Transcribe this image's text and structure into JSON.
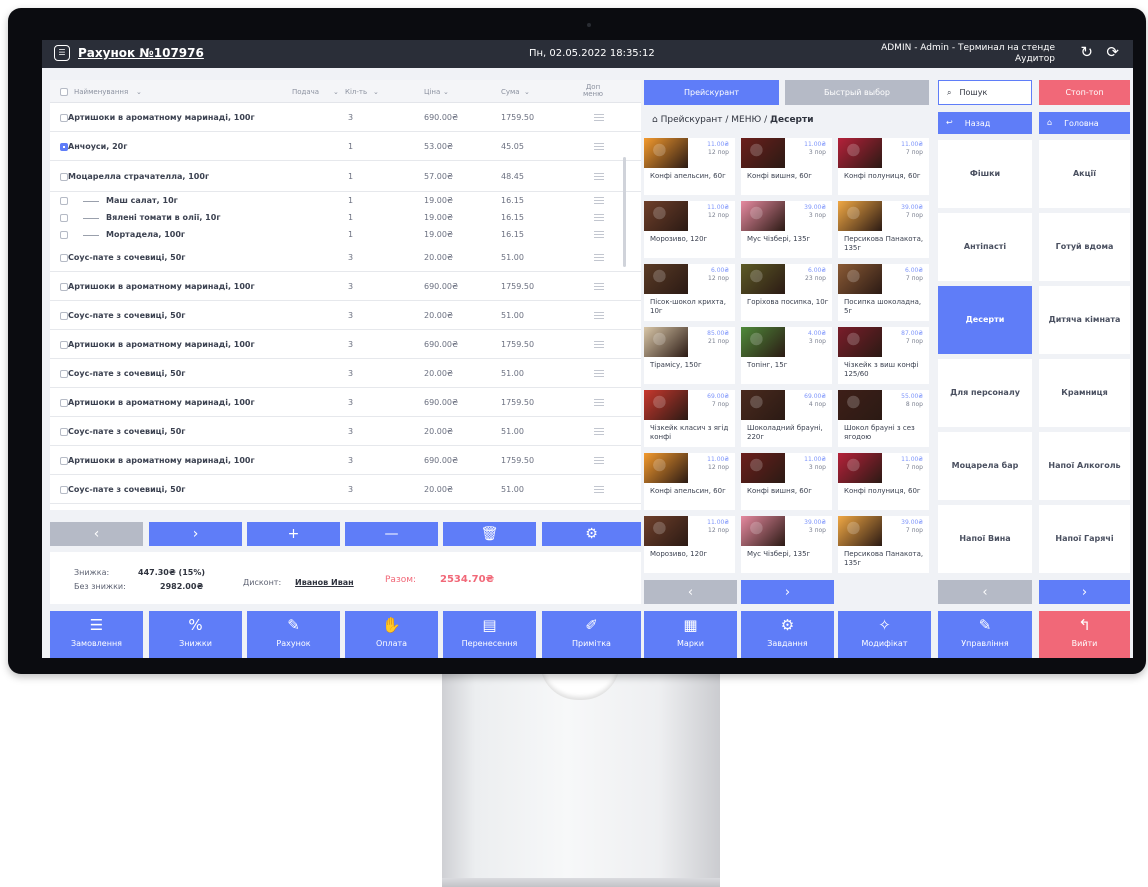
{
  "header": {
    "title": "Рахунок №107976",
    "datetime": "Пн, 02.05.2022  18:35:12",
    "user_line1": "ADMIN - Admin - Терминал на стенде",
    "user_line2": "Аудитор",
    "icon_sync": "sync-icon",
    "icon_refresh": "refresh-icon"
  },
  "table": {
    "columns": {
      "name": "Найменування",
      "serve": "Подача",
      "qty": "Кіл-ть",
      "price": "Ціна",
      "sum": "Сума",
      "menu": "Доп меню"
    },
    "rows": [
      {
        "name": "Артишоки в ароматному маринаді, 100г",
        "qty": "3",
        "price": "690.00₴",
        "sum": "1759.50",
        "checked": false
      },
      {
        "name": "Анчоуси, 20г",
        "qty": "1",
        "price": "53.00₴",
        "sum": "45.05",
        "checked": true
      },
      {
        "name": "Моцарелла страчателла, 100г",
        "qty": "1",
        "price": "57.00₴",
        "sum": "48.45",
        "checked": false
      },
      {
        "name": "Маш салат, 10г",
        "qty": "1",
        "price": "19.00₴",
        "sum": "16.15",
        "sub": true
      },
      {
        "name": "Вялені томати в олії, 10г",
        "qty": "1",
        "price": "19.00₴",
        "sum": "16.15",
        "sub": true
      },
      {
        "name": "Мортадела, 100г",
        "qty": "1",
        "price": "19.00₴",
        "sum": "16.15",
        "sub": true
      },
      {
        "name": "Соус-пате з сочевиці, 50г",
        "qty": "3",
        "price": "20.00₴",
        "sum": "51.00"
      },
      {
        "name": "Артишоки в ароматному маринаді, 100г",
        "qty": "3",
        "price": "690.00₴",
        "sum": "1759.50"
      },
      {
        "name": "Соус-пате з сочевиці, 50г",
        "qty": "3",
        "price": "20.00₴",
        "sum": "51.00"
      },
      {
        "name": "Артишоки в ароматному маринаді, 100г",
        "qty": "3",
        "price": "690.00₴",
        "sum": "1759.50"
      },
      {
        "name": "Соус-пате з сочевиці, 50г",
        "qty": "3",
        "price": "20.00₴",
        "sum": "51.00"
      },
      {
        "name": "Артишоки в ароматному маринаді, 100г",
        "qty": "3",
        "price": "690.00₴",
        "sum": "1759.50"
      },
      {
        "name": "Соус-пате з сочевиці, 50г",
        "qty": "3",
        "price": "20.00₴",
        "sum": "51.00"
      },
      {
        "name": "Артишоки в ароматному маринаді, 100г",
        "qty": "3",
        "price": "690.00₴",
        "sum": "1759.50"
      },
      {
        "name": "Соус-пате з сочевиці, 50г",
        "qty": "3",
        "price": "20.00₴",
        "sum": "51.00"
      }
    ]
  },
  "toolbar": {
    "prev": "‹",
    "next": "›",
    "add": "+",
    "remove": "—",
    "delete_icon": "trash-icon",
    "settings_icon": "gear-icon"
  },
  "summary": {
    "discount_label": "Знижка:",
    "discount_value": "447.30₴ (15%)",
    "nodiscount_label": "Без знижки:",
    "nodiscount_value": "2982.00₴",
    "card_label": "Дисконт:",
    "card_value": "Иванов Иван",
    "total_label": "Разом:",
    "total_value": "2534.70₴"
  },
  "bottom_bar": [
    {
      "label": "Замовлення",
      "icon": "order-icon",
      "glyph": "☰"
    },
    {
      "label": "Знижки",
      "icon": "discount-icon",
      "glyph": "%"
    },
    {
      "label": "Рахунок",
      "icon": "invoice-icon",
      "glyph": "✎"
    },
    {
      "label": "Оплата",
      "icon": "payment-icon",
      "glyph": "✋"
    },
    {
      "label": "Перенесення",
      "icon": "transfer-icon",
      "glyph": "▤"
    },
    {
      "label": "Примітка",
      "icon": "note-icon",
      "glyph": "✐"
    },
    {
      "label": "Марки",
      "icon": "marks-icon",
      "glyph": "▦"
    },
    {
      "label": "Завдання",
      "icon": "task-icon",
      "glyph": "⚙"
    },
    {
      "label": "Модифікат",
      "icon": "modifier-icon",
      "glyph": "✧"
    },
    {
      "label": "Управління",
      "icon": "wrench-icon",
      "glyph": "✎"
    },
    {
      "label": "Вийти",
      "icon": "exit-icon",
      "glyph": "↰"
    }
  ],
  "menu": {
    "tab_price": "Прейскурант",
    "tab_quick": "Быстрый выбор",
    "crumb_root": "Прейскурант",
    "crumb_mid": "МЕНЮ",
    "crumb_cur": "Десерти",
    "home_icon": "home-icon",
    "items": [
      {
        "name": "Конфі апельсин, 60г",
        "price": "11.00₴",
        "portions": "12 пор",
        "color": "#f39a2e"
      },
      {
        "name": "Конфі вишня, 60г",
        "price": "11.00₴",
        "portions": "3 пор",
        "color": "#6b1f1c"
      },
      {
        "name": "Конфі полуниця, 60г",
        "price": "11.00₴",
        "portions": "7 пор",
        "color": "#b5213a"
      },
      {
        "name": "Морозиво, 120г",
        "price": "11.00₴",
        "portions": "12 пор",
        "color": "#6e3f2a"
      },
      {
        "name": "Мус Чізбері, 135г",
        "price": "39.00₴",
        "portions": "3 пор",
        "color": "#e68aa0"
      },
      {
        "name": "Персикова Панакота, 135г",
        "price": "39.00₴",
        "portions": "7 пор",
        "color": "#f0a844"
      },
      {
        "name": "Пісок-шокол крихта, 10г",
        "price": "6.00₴",
        "portions": "12 пор",
        "color": "#5a3b26"
      },
      {
        "name": "Горіхова посипка, 10г",
        "price": "6.00₴",
        "portions": "23 пор",
        "color": "#5c5a26"
      },
      {
        "name": "Посипка шоколадна, 5г",
        "price": "6.00₴",
        "portions": "7 пор",
        "color": "#8a5a35"
      },
      {
        "name": "Тірамісу, 150г",
        "price": "85.00₴",
        "portions": "21 пор",
        "color": "#d9c7a8"
      },
      {
        "name": "Топінг, 15г",
        "price": "4.00₴",
        "portions": "3 пор",
        "color": "#4f8a3a"
      },
      {
        "name": "Чізкейк з виш конфі 125/60",
        "price": "87.00₴",
        "portions": "7 пор",
        "color": "#7a1d2a"
      },
      {
        "name": "Чізкейк класич з ягід конфі",
        "price": "69.00₴",
        "portions": "7 пор",
        "color": "#c8382e"
      },
      {
        "name": "Шоколадний брауні, 220г",
        "price": "69.00₴",
        "portions": "4 пор",
        "color": "#4a2a1e"
      },
      {
        "name": "Шокол брауні з сез ягодою",
        "price": "55.00₴",
        "portions": "8 пор",
        "color": "#3e1f18"
      },
      {
        "name": "Конфі апельсин, 60г",
        "price": "11.00₴",
        "portions": "12 пор",
        "color": "#f39a2e"
      },
      {
        "name": "Конфі вишня, 60г",
        "price": "11.00₴",
        "portions": "3 пор",
        "color": "#6b1f1c"
      },
      {
        "name": "Конфі полуниця, 60г",
        "price": "11.00₴",
        "portions": "7 пор",
        "color": "#b5213a"
      },
      {
        "name": "Морозиво, 120г",
        "price": "11.00₴",
        "portions": "12 пор",
        "color": "#6e3f2a"
      },
      {
        "name": "Мус Чізбері, 135г",
        "price": "39.00₴",
        "portions": "3 пор",
        "color": "#e68aa0"
      },
      {
        "name": "Персикова Панакота, 135г",
        "price": "39.00₴",
        "portions": "7 пор",
        "color": "#f0a844"
      }
    ],
    "prev": "‹",
    "next": "›"
  },
  "right": {
    "search_label": "Пошук",
    "search_icon": "search-icon",
    "stop_label": "Стоп-топ",
    "back_label": "Назад",
    "back_icon": "back-arrow-icon",
    "home_label": "Головна",
    "home_icon": "home-icon",
    "categories": [
      {
        "label": "Фішки",
        "active": false
      },
      {
        "label": "Акції",
        "active": false
      },
      {
        "label": "Антіпасті",
        "active": false
      },
      {
        "label": "Готуй вдома",
        "active": false
      },
      {
        "label": "Десерти",
        "active": true
      },
      {
        "label": "Дитяча кімната",
        "active": false
      },
      {
        "label": "Для персоналу",
        "active": false
      },
      {
        "label": "Крамниця",
        "active": false
      },
      {
        "label": "Моцарела бар",
        "active": false
      },
      {
        "label": "Напої Алкоголь",
        "active": false
      },
      {
        "label": "Напої Вина",
        "active": false
      },
      {
        "label": "Напої Гарячі",
        "active": false
      }
    ],
    "prev": "‹",
    "next": "›"
  },
  "colors": {
    "accent": "#5f7df8",
    "danger": "#f16878",
    "disabled": "#b5bac6",
    "header": "#2a2e38"
  }
}
